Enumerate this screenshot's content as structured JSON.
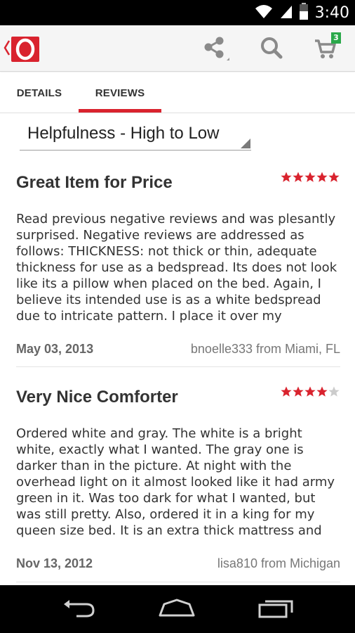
{
  "status_bar": {
    "time": "3:40",
    "icons": [
      "wifi-icon",
      "cell-signal-icon",
      "battery-icon"
    ]
  },
  "app_bar": {
    "logo": "overstock-logo",
    "actions": [
      "share-icon",
      "search-icon",
      "cart-icon"
    ],
    "cart_count": "3",
    "brand_color": "#d9232e",
    "badge_color": "#2aa84a"
  },
  "tabs": [
    {
      "label": "DETAILS",
      "selected": false
    },
    {
      "label": "REVIEWS",
      "selected": true
    }
  ],
  "sort": {
    "selected": "Helpfulness - High to Low"
  },
  "reviews": [
    {
      "title": "Great Item for Price",
      "rating": 5,
      "max_rating": 5,
      "body": "Read previous negative reviews and was plesantly surprised. Negative reviews are addressed as follows: THICKNESS: not thick or thin, adequate thickness for use as a bedspread. Its does not look like its a pillow when placed on the bed. Again, I believe its intended use is as  a white bedspread due to intricate pattern. I place it over my comforter...whe",
      "date": "May 03, 2013",
      "author": "bnoelle333 from Miami, FL"
    },
    {
      "title": "Very Nice Comforter",
      "rating": 4,
      "max_rating": 5,
      "body": "Ordered white and gray.  The white is a bright white, exactly what I wanted.  The gray one is darker than in the picture.  At night with the overhead light on it almost looked like it had army green in it.  Was too dark for what I wanted, but was still pretty.  Also, ordered it in a king for my queen size bed.  It is an extra thick mattress and the king is a little to big bu...t",
      "date": "Nov 13, 2012",
      "author": "lisa810 from Michigan"
    }
  ],
  "colors": {
    "star_filled": "#d9232e",
    "star_empty": "#cccccc"
  },
  "nav_bar": {
    "buttons": [
      "back-icon",
      "home-icon",
      "recents-icon"
    ]
  }
}
